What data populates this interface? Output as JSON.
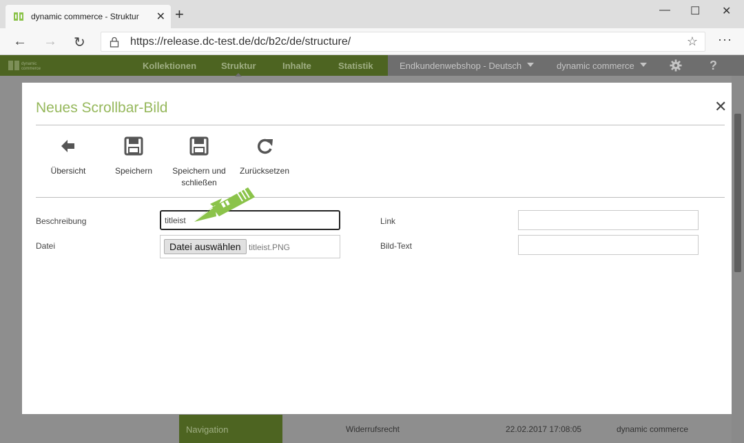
{
  "browser": {
    "tab_title": "dynamic commerce - Struktur",
    "tab_close": "✕",
    "new_tab": "+",
    "window_minimize": "—",
    "window_maximize": "☐",
    "window_close": "✕",
    "back": "←",
    "forward": "→",
    "reload": "↻",
    "url": "https://release.dc-test.de/dc/b2c/de/structure/",
    "favorite": "☆",
    "more": "···"
  },
  "appnav": {
    "tabs": [
      {
        "label": "Kollektionen"
      },
      {
        "label": "Struktur"
      },
      {
        "label": "Inhalte"
      },
      {
        "label": "Statistik"
      }
    ],
    "shop_select": "Endkundenwebshop - Deutsch",
    "tenant_select": "dynamic commerce",
    "help": "?"
  },
  "modal": {
    "title": "Neues Scrollbar-Bild",
    "close": "✕",
    "toolbar": [
      {
        "label": "Übersicht",
        "icon": "arrow-left-icon"
      },
      {
        "label": "Speichern",
        "icon": "floppy-disk-icon"
      },
      {
        "label": "Speichern und schließen",
        "icon": "floppy-disk-icon"
      },
      {
        "label": "Zurücksetzen",
        "icon": "redo-icon"
      }
    ],
    "form": {
      "description_label": "Beschreibung",
      "description_value": "titleist",
      "file_label": "Datei",
      "file_button": "Datei auswählen",
      "file_name": "titleist.PNG",
      "link_label": "Link",
      "link_value": "",
      "image_text_label": "Bild-Text",
      "image_text_value": ""
    }
  },
  "background_row": {
    "nav_item": "Navigation",
    "page": "Widerrufsrecht",
    "date": "22.02.2017 17:08:05",
    "author": "dynamic commerce"
  },
  "colors": {
    "brand_green": "#96b85c",
    "nav_green": "#4d6421",
    "arrow_green": "#8bc34a"
  }
}
